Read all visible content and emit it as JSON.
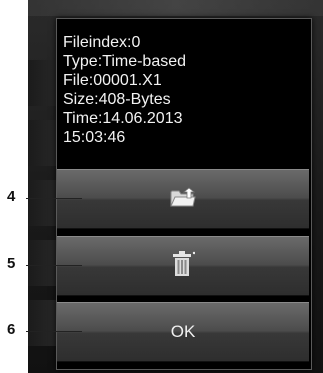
{
  "dialog": {
    "info_lines": [
      "Fileindex:0",
      "Type:Time-based",
      "File:00001.X1",
      "Size:408-Bytes",
      "Time:14.06.2013",
      "15:03:46"
    ],
    "buttons": {
      "export_icon": "folder-export-icon",
      "delete_icon": "trash-icon",
      "ok_label": "OK"
    }
  },
  "callouts": [
    "4",
    "5",
    "6"
  ],
  "colors": {
    "dialog_bg": "#000000",
    "text": "#f2f2f2",
    "button_top": "#6a6a6a",
    "button_bottom": "#2e2e2e"
  }
}
